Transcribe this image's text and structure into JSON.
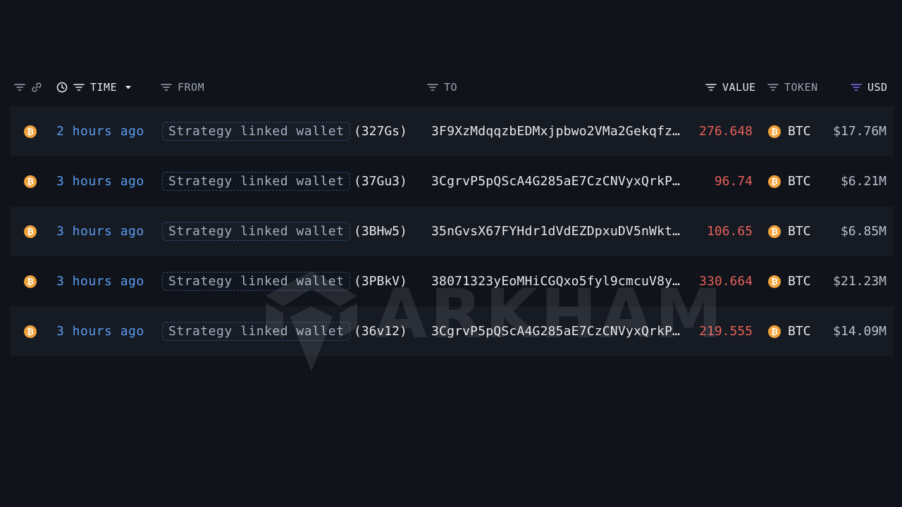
{
  "header": {
    "time_label": "TIME",
    "from_label": "FROM",
    "to_label": "TO",
    "value_label": "VALUE",
    "token_label": "TOKEN",
    "usd_label": "USD"
  },
  "rows": [
    {
      "time": "2 hours ago",
      "from_entity": "Strategy linked wallet",
      "from_addr": "(327Gs)",
      "to": "3F9XzMdqqzbEDMxjpbwo2VMa2Gekqfz…",
      "value": "276.648",
      "token": "BTC",
      "usd": "$17.76M"
    },
    {
      "time": "3 hours ago",
      "from_entity": "Strategy linked wallet",
      "from_addr": "(37Gu3)",
      "to": "3CgrvP5pQScA4G285aE7CzCNVyxQrkP…",
      "value": "96.74",
      "token": "BTC",
      "usd": "$6.21M"
    },
    {
      "time": "3 hours ago",
      "from_entity": "Strategy linked wallet",
      "from_addr": "(3BHw5)",
      "to": "35nGvsX67FYHdr1dVdEZDpxuDV5nWkt…",
      "value": "106.65",
      "token": "BTC",
      "usd": "$6.85M"
    },
    {
      "time": "3 hours ago",
      "from_entity": "Strategy linked wallet",
      "from_addr": "(3PBkV)",
      "to": "38071323yEoMHiCGQxo5fyl9cmcuV8y…",
      "value": "330.664",
      "token": "BTC",
      "usd": "$21.23M"
    },
    {
      "time": "3 hours ago",
      "from_entity": "Strategy linked wallet",
      "from_addr": "(36v12)",
      "to": "3CgrvP5pQScA4G285aE7CzCNVyxQrkP…",
      "value": "219.555",
      "token": "BTC",
      "usd": "$14.09M"
    }
  ],
  "icons": {
    "coin": "bitcoin-icon",
    "filter": "filter-icon",
    "link": "link-icon",
    "clock": "clock-icon",
    "sort": "caret-down-icon"
  },
  "colors": {
    "time": "#5b9cf0",
    "value": "#e5605a",
    "coin": "#f2a33a",
    "usd_filter_active": "#8b6cf0"
  },
  "watermark": {
    "text": "ARKHAM"
  }
}
